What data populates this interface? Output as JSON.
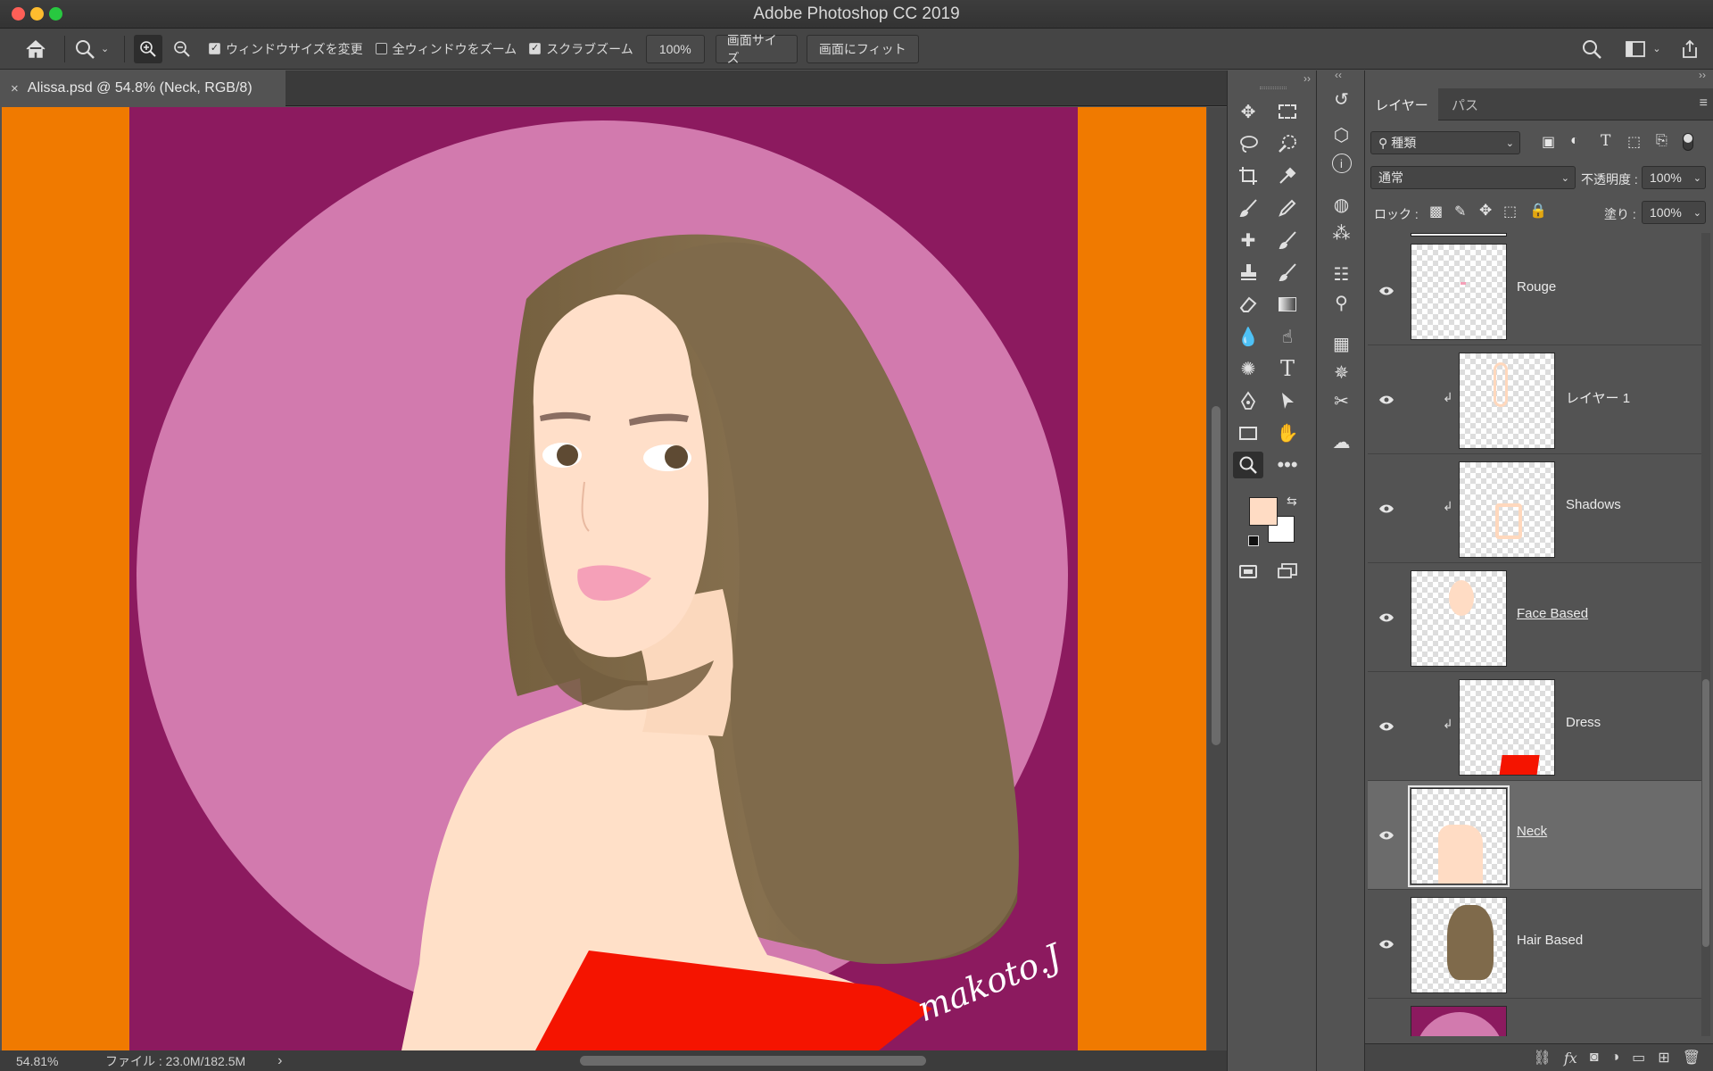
{
  "window": {
    "title": "Adobe Photoshop CC 2019"
  },
  "options_bar": {
    "resize_windows_label": "ウィンドウサイズを変更",
    "zoom_all_windows_label": "全ウィンドウをズーム",
    "scrubby_zoom_label": "スクラブズーム",
    "zoom_value": "100%",
    "actual_pixels_label": "画面サイズ",
    "fit_screen_label": "画面にフィット",
    "resize_windows_checked": true,
    "zoom_all_windows_checked": false,
    "scrubby_zoom_checked": true
  },
  "document": {
    "tab_label": "Alissa.psd @ 54.8% (Neck, RGB/8)",
    "close_glyph": "×",
    "signature_text": "makoto.J"
  },
  "status": {
    "zoom": "54.81%",
    "file_info": "ファイル : 23.0M/182.5M",
    "arrow": "›"
  },
  "colors": {
    "foreground": "#ffdcc4",
    "background": "#ffffff",
    "canvas_bg": "#8c1a5f",
    "circle": "#d27aae",
    "sides": "#f07a00",
    "hair": "#7f6a4b",
    "skin": "#ffe0c8",
    "dress": "#f51400"
  },
  "layers_panel": {
    "tab_layers": "レイヤー",
    "tab_paths": "パス",
    "filter_kind": "種類",
    "blend_mode": "通常",
    "opacity_label": "不透明度 :",
    "opacity_value": "100%",
    "lock_label": "ロック :",
    "fill_label": "塗り :",
    "fill_value": "100%",
    "layers": [
      {
        "name": "Rouge",
        "clipped": false,
        "underlined": false,
        "selected": false
      },
      {
        "name": "レイヤー 1",
        "clipped": true,
        "underlined": false,
        "selected": false
      },
      {
        "name": "Shadows",
        "clipped": true,
        "underlined": false,
        "selected": false
      },
      {
        "name": "Face Based",
        "clipped": false,
        "underlined": true,
        "selected": false
      },
      {
        "name": "Dress",
        "clipped": true,
        "underlined": false,
        "selected": false
      },
      {
        "name": "Neck",
        "clipped": false,
        "underlined": true,
        "selected": true
      },
      {
        "name": "Hair Based",
        "clipped": false,
        "underlined": false,
        "selected": false
      }
    ]
  },
  "icons": {
    "home": "home-icon",
    "zoom": "zoom-tool-icon",
    "share": "share-icon",
    "search": "search-icon",
    "workspace": "workspace-icon"
  }
}
